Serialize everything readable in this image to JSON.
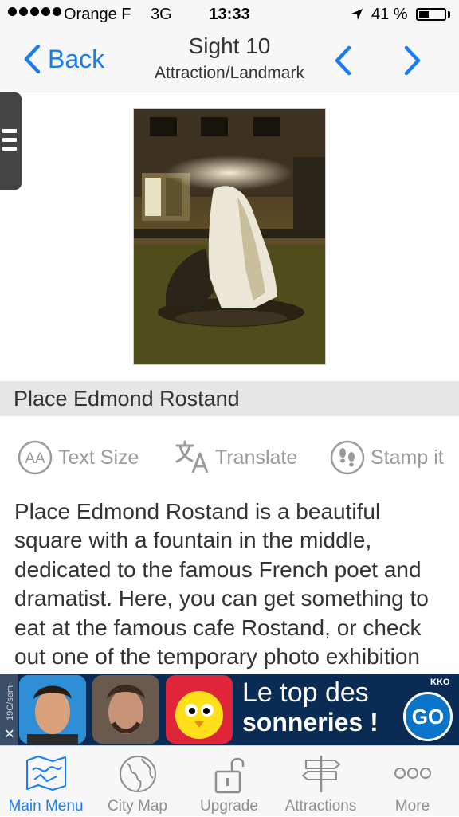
{
  "status_bar": {
    "carrier": "Orange F",
    "network": "3G",
    "time": "13:33",
    "battery_percent": "41 %",
    "battery_level": 0.41,
    "signal_dots": 5
  },
  "nav": {
    "back_label": "Back",
    "title": "Sight 10",
    "subtitle": "Attraction/Landmark"
  },
  "place": {
    "name": "Place Edmond Rostand",
    "description": "Place Edmond Rostand is a beautiful square with a fountain in the middle, dedicated to the famous French poet and dramatist. Here, you can get something to eat at the famous cafe Rostand, or check out one of the temporary photo exhibition"
  },
  "actions": {
    "text_size": "Text Size",
    "translate": "Translate",
    "stamp": "Stamp it"
  },
  "ad": {
    "side_text": "19C/sem",
    "line1": "Le top des",
    "line2": "sonneries !",
    "button": "GO",
    "brand": "KKO",
    "close": "✕"
  },
  "tabs": [
    {
      "label": "Main Menu",
      "icon": "map-icon",
      "active": true
    },
    {
      "label": "City Map",
      "icon": "globe-icon",
      "active": false
    },
    {
      "label": "Upgrade",
      "icon": "lock-icon",
      "active": false
    },
    {
      "label": "Attractions",
      "icon": "signpost-icon",
      "active": false
    },
    {
      "label": "More",
      "icon": "more-icon",
      "active": false
    }
  ],
  "colors": {
    "accent": "#1a7cf5",
    "bar_bg": "#f7f7f7",
    "name_bar": "#e6e6e6",
    "ad_bg": "#0a2b53",
    "inactive": "#8e8e8e"
  }
}
